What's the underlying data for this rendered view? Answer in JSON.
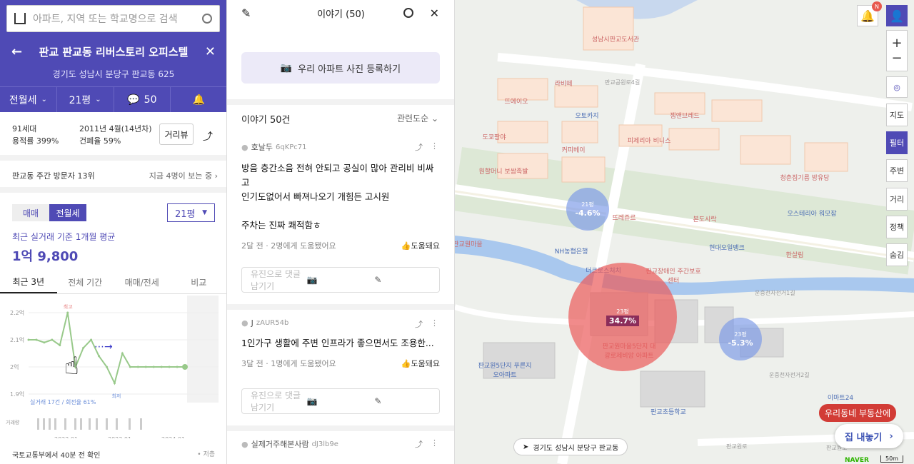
{
  "search": {
    "placeholder": "아파트, 지역 또는 학교명으로 검색"
  },
  "header": {
    "title": "판교 판교동 리버스토리 오피스텔",
    "address": "경기도 성남시 분당구 판교동 625",
    "deal_type": "전월세",
    "size": "21평",
    "comment_count": "50"
  },
  "info": {
    "households": "91세대",
    "floor_ratio": "용적률 399%",
    "built": "2011년 4월(14년차)",
    "coverage": "건폐율 59%",
    "street_view": "거리뷰"
  },
  "visitors": {
    "label": "판교동 주간 방문자 13위",
    "now": "지금 4명이 보는 중"
  },
  "price": {
    "tab_sale": "매매",
    "tab_rent": "전월세",
    "size_select": "21평",
    "avg_label": "최근 실거래 기준 1개월 평균",
    "avg_value": "1억 9,800"
  },
  "period_tabs": [
    "최근 3년",
    "전체 기간",
    "매매/전세",
    "비교"
  ],
  "chart_data": {
    "type": "line",
    "y_ticks": [
      "2.2억",
      "2.1억",
      "2억",
      "1.9억"
    ],
    "x_ticks": [
      "2022.01",
      "2023.01",
      "2024.01"
    ],
    "max_label": "최고",
    "min_label": "최저",
    "trade_info": "실거래 17건 / 회전율 61%",
    "volume_label": "거래량",
    "series": [
      {
        "values": [
          2.1,
          2.1,
          2.09,
          2.1,
          2.08,
          2.2,
          2.0,
          2.07,
          2.1,
          2.04,
          2.0,
          1.94,
          2.05,
          2.0,
          2.0,
          2.0,
          2.0,
          2.0,
          2.0,
          2.0,
          2.0
        ]
      }
    ]
  },
  "footer": {
    "source": "국토교통부에서 40분 전 확인",
    "save": "저층"
  },
  "stories": {
    "title": "이야기 (50)",
    "photo_button": "우리 아파트 사진 등록하기",
    "count_label": "이야기 50건",
    "sort": "관련도순",
    "posts": [
      {
        "author": "호날두",
        "uid": "6qKPc71",
        "body": "방음 층간소음 전혀 안되고 공실이 많아 관리비 비싸고\n인기도없어서 빠져나오기 개힘든 고시원\n\n주차는 진짜 쾌적함ㅎ",
        "meta": "2달 전 · 2명에게 도움됐어요",
        "help": "도움돼요"
      },
      {
        "author": "J",
        "uid": "zAUR54b",
        "body": "1인가구 생활에 주변 인프라가 좋으면서도 조용한...",
        "meta": "3달 전 · 1명에게 도움됐어요",
        "help": "도움돼요"
      },
      {
        "author": "실제거주해본사람",
        "uid": "dJ3lb9e",
        "body": "",
        "meta": "",
        "help": ""
      }
    ],
    "comment_placeholder": "유진으로 댓글 남기기"
  },
  "map": {
    "controls": [
      "지도",
      "필터",
      "주변",
      "거리",
      "정책",
      "숨김"
    ],
    "location": "경기도 성남시 분당구 판교동",
    "promo_top": "우리동네 부동산에",
    "promo_btn": "집 내놓기",
    "brand": "NAVER",
    "scale": "50m",
    "notif_badge": "N",
    "bubbles": [
      {
        "size": "21평",
        "change": "-4.6%"
      },
      {
        "size": "23평",
        "change": "34.7%"
      },
      {
        "size": "23평",
        "change": "-5.3%"
      }
    ],
    "places": [
      "성남시판교도서관",
      "라비떼",
      "뜨에이오",
      "오토카지",
      "젬앤브레드",
      "도쿄팡야",
      "커피베이",
      "피제리아 비니스",
      "원할머니 보쌈족발",
      "청춘집기름 방유당",
      "뜨레쥬르",
      "본도시락",
      "오스테리아 워모잠",
      "NH농협은행",
      "현대오일뱅크",
      "한살림",
      "더크로스처치",
      "판교장애인 주간보호센터",
      "판교원마을5단지 대광로제비앙 아파트",
      "판교원5단지 푸른지오아파트",
      "판교초등학교",
      "이마트24",
      "판교원마을"
    ],
    "roads": [
      "판교공원로4길",
      "운중천자전거1길",
      "운중천자전거2길",
      "판교원로",
      "판교원로"
    ]
  }
}
